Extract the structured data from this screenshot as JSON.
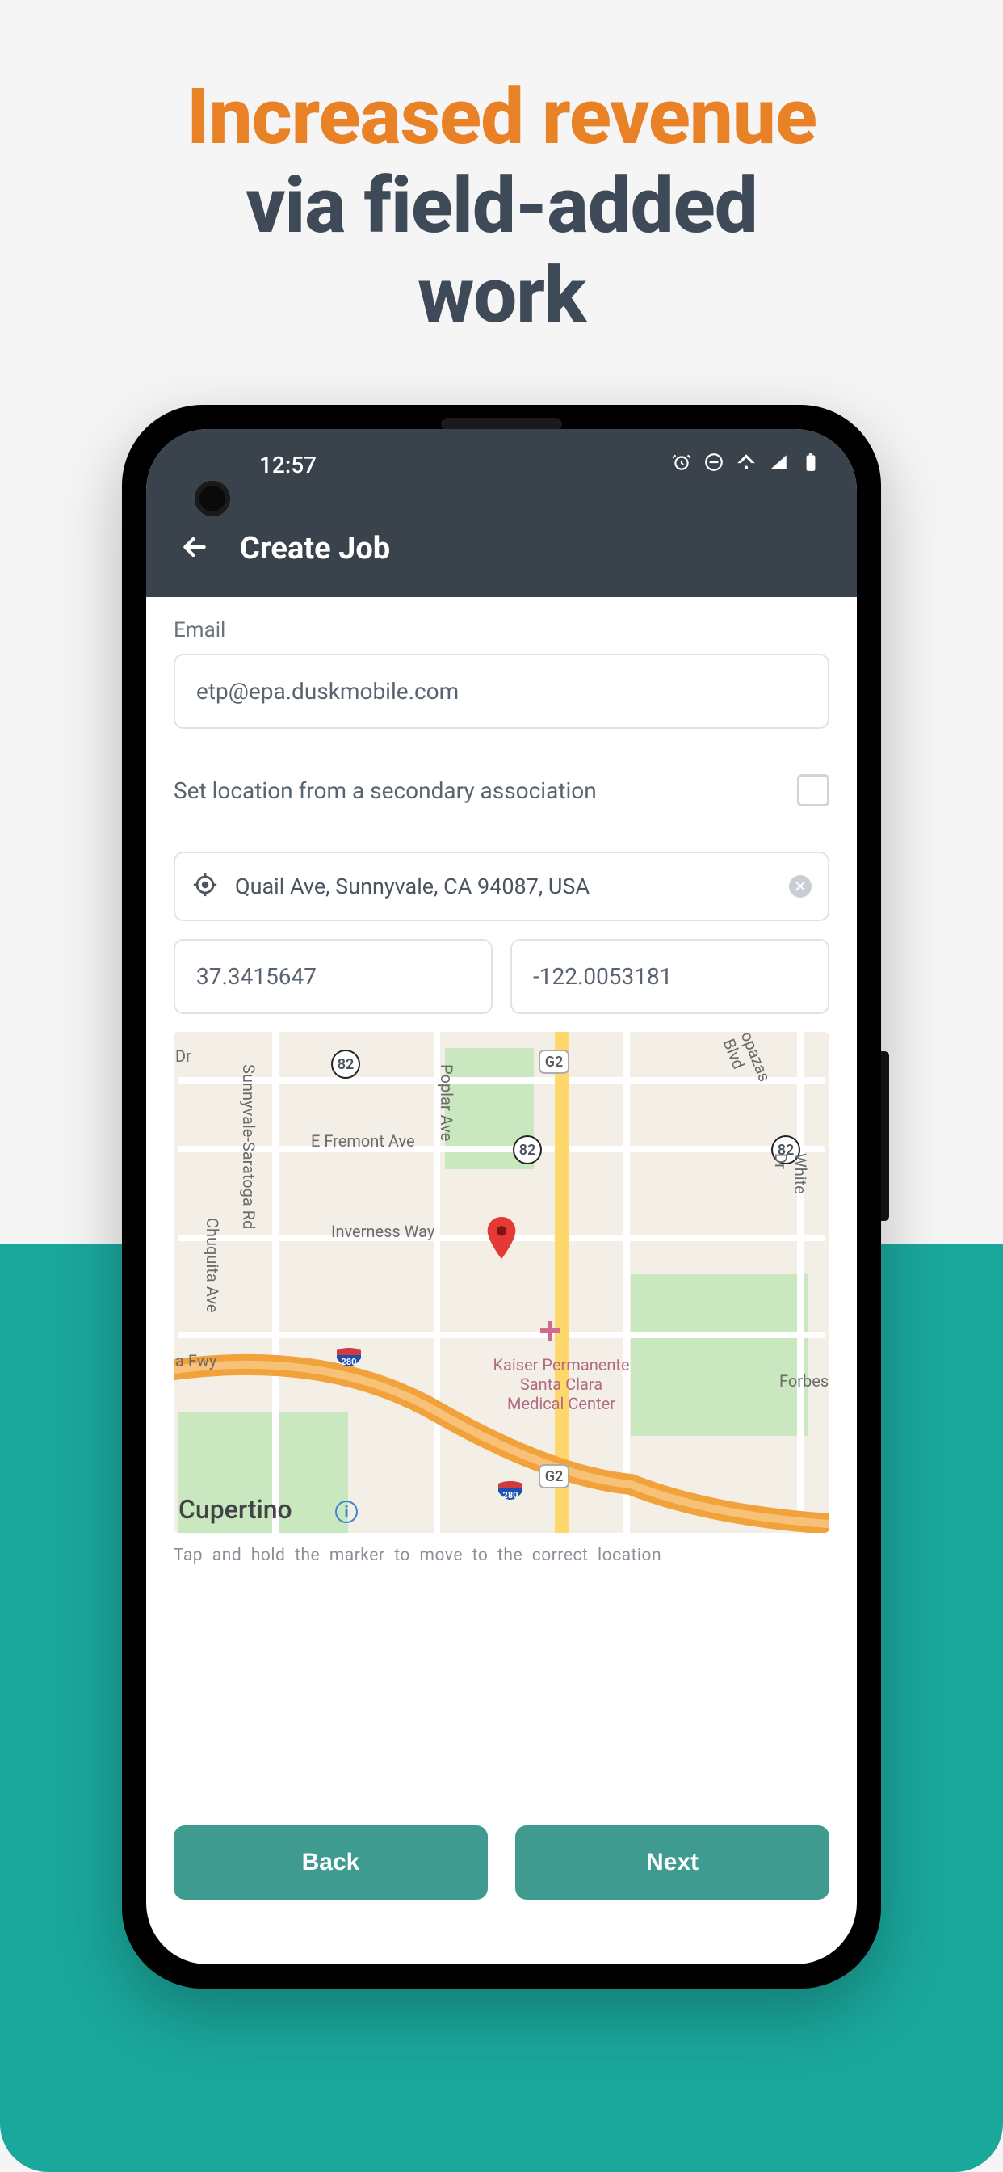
{
  "hero": {
    "line1": "Increased revenue",
    "line2": "via field-added",
    "line3": "work"
  },
  "statusbar": {
    "time": "12:57"
  },
  "appbar": {
    "title": "Create Job"
  },
  "form": {
    "email_label": "Email",
    "email_value": "etp@epa.duskmobile.com",
    "secondary_label": "Set location from a secondary association",
    "address": "Quail Ave, Sunnyvale, CA 94087, USA",
    "lat": "37.3415647",
    "lng": "-122.0053181",
    "map_hint": "Tap and hold the marker to move to the correct location"
  },
  "map": {
    "city": "Cupertino",
    "streets": {
      "fremont": "E Fremont Ave",
      "inverness": "Inverness Way",
      "poplar": "Poplar Ave",
      "saratoga": "Sunnyvale-Saratoga Rd",
      "chiquita": "Chuquita Ave",
      "opazas": "opazas Blvd",
      "white": "White Dr",
      "forbes": "Forbes",
      "dr": "Dr",
      "fwy": "a Fwy"
    },
    "poi": {
      "kaiser1": "Kaiser Permanente",
      "kaiser2": "Santa Clara",
      "kaiser3": "Medical Center"
    },
    "routes": {
      "g2": "G2",
      "r82": "82",
      "i280": "280"
    }
  },
  "buttons": {
    "back": "Back",
    "next": "Next"
  }
}
